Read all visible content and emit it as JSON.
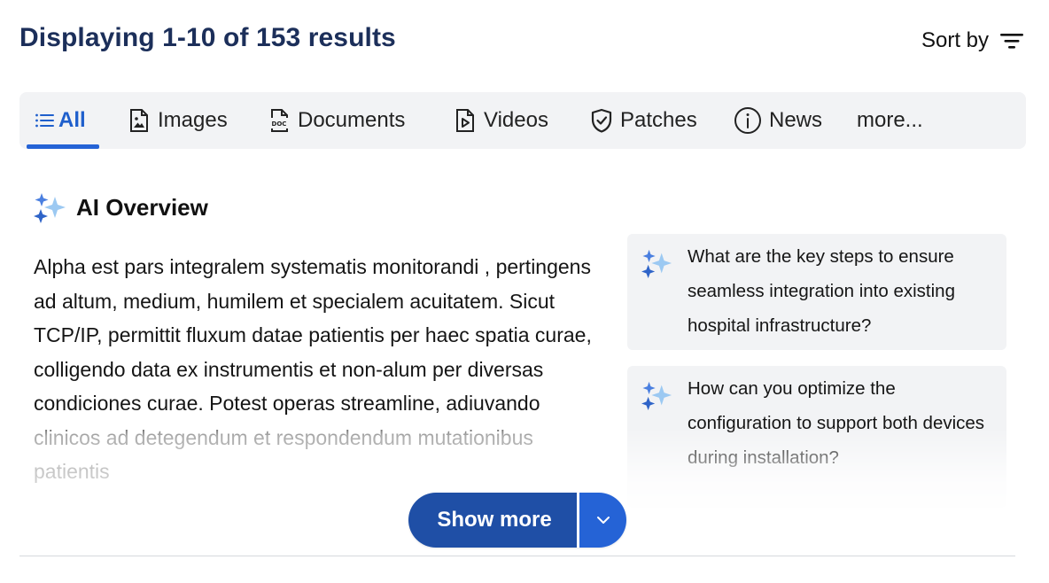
{
  "header": {
    "results_text": "Displaying 1-10 of 153 results",
    "sort_label": "Sort by"
  },
  "tabs": [
    {
      "label": "All",
      "icon": "list-icon",
      "active": true
    },
    {
      "label": "Images",
      "icon": "image-file-icon",
      "active": false
    },
    {
      "label": "Documents",
      "icon": "doc-file-icon",
      "active": false
    },
    {
      "label": "Videos",
      "icon": "video-file-icon",
      "active": false
    },
    {
      "label": "Patches",
      "icon": "shield-check-icon",
      "active": false
    },
    {
      "label": "News",
      "icon": "info-circle-icon",
      "active": false
    },
    {
      "label": "more...",
      "active": false
    }
  ],
  "ai_overview": {
    "title": "AI Overview",
    "icon": "sparkle-icon",
    "body": "Alpha est pars integralem systematis monitorandi , pertingens ad altum, medium, humilem et specialem acuitatem. Sicut TCP/IP, permittit fluxum datae patientis per haec spatia curae, colligendo data ex instrumentis et non-alum per diversas condiciones curae. Potest operas streamline, adiuvando clinicos ad detegendum et respondendum mutationibus patientis"
  },
  "suggested_questions": [
    {
      "text": "What are the key steps to ensure seamless integration into existing hospital infrastructure?"
    },
    {
      "text": "How can you optimize the configuration  to support both devices during installation?"
    }
  ],
  "show_more": {
    "label": "Show more"
  },
  "colors": {
    "title": "#1c2f5a",
    "accent": "#2563d6",
    "button_dark": "#1f4fa6",
    "tab_bg": "#f2f3f5",
    "sparkle_dark": "#3a6fd8",
    "sparkle_light": "#8fc2f0"
  }
}
